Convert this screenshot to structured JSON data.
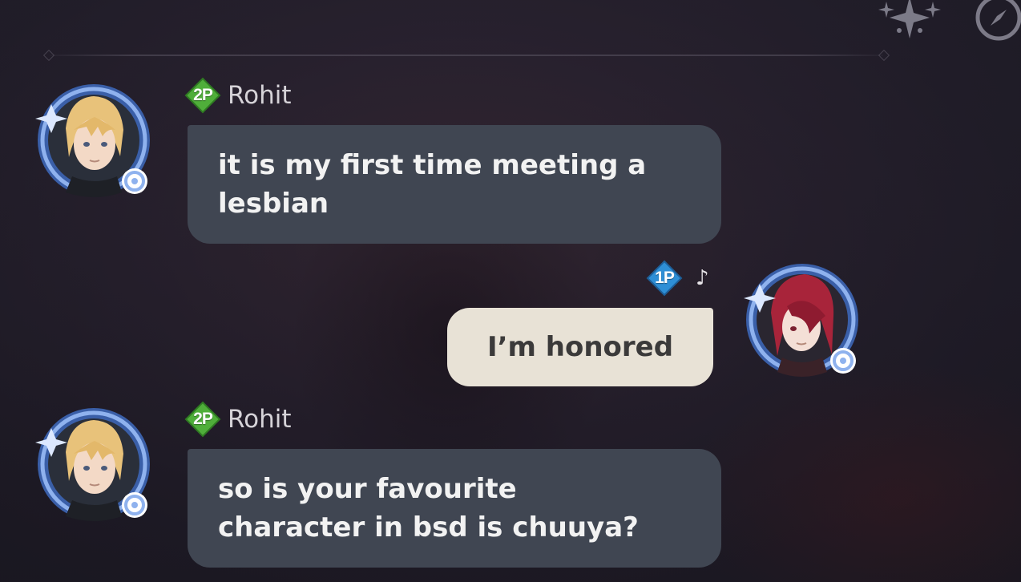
{
  "chat": {
    "messages": [
      {
        "player_badge": "2P",
        "player_name": "Rohit",
        "text": "it is my first time meeting a\nlesbian",
        "side": "left",
        "avatar": "blonde-character-avatar"
      },
      {
        "player_badge": "1P",
        "player_name": "",
        "status_icon": "music-note-icon",
        "status_glyph": "♪",
        "text": "I’m honored",
        "side": "right",
        "avatar": "red-haired-character-avatar"
      },
      {
        "player_badge": "2P",
        "player_name": "Rohit",
        "text": "so is your favourite\ncharacter in bsd is chuuya?",
        "side": "left",
        "avatar": "blonde-character-avatar"
      }
    ]
  },
  "colors": {
    "bubble_dark": "#404652",
    "bubble_light": "#e8e2d6",
    "badge_2p": "#4fae3a",
    "badge_1p": "#2e8fd6",
    "avatar_ring": "#4a78c8"
  },
  "icons": {
    "top_right": [
      "paimon-menu-icon",
      "compass-icon"
    ]
  }
}
